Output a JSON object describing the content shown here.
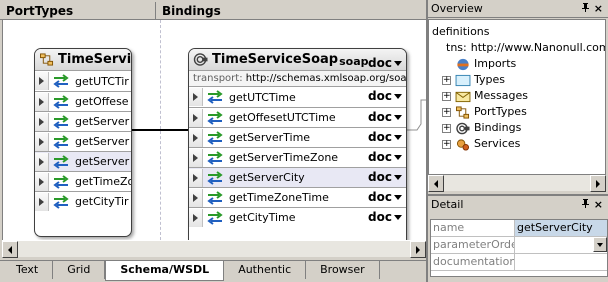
{
  "main": {
    "headers": {
      "porttypes": "PortTypes",
      "bindings": "Bindings"
    },
    "porttype_box": {
      "title": "TimeServic",
      "operations": [
        "getUTCTir",
        "getOffese",
        "getServer",
        "getServer",
        "getServer",
        "getTimeZo",
        "getCityTir"
      ]
    },
    "binding_box": {
      "title": "TimeServiceSoap",
      "subtitle": "soap",
      "style": "doc",
      "transport_label": "transport:",
      "transport_value": "http://schemas.xmlsoap.org/soa",
      "operations": [
        {
          "label": "getUTCTime",
          "style": "doc"
        },
        {
          "label": "getOffesetUTCTime",
          "style": "doc"
        },
        {
          "label": "getServerTime",
          "style": "doc"
        },
        {
          "label": "getServerTimeZone",
          "style": "doc"
        },
        {
          "label": "getServerCity",
          "style": "doc"
        },
        {
          "label": "getTimeZoneTime",
          "style": "doc"
        },
        {
          "label": "getCityTime",
          "style": "doc"
        }
      ]
    },
    "tabs": [
      "Text",
      "Grid",
      "Schema/WSDL",
      "Authentic",
      "Browser"
    ],
    "active_tab": "Schema/WSDL"
  },
  "overview": {
    "title": "Overview",
    "pin": "\u0004",
    "close": "×",
    "definitions": "definitions",
    "tns_label": "tns:",
    "tns_value": "http://www.Nanonull.com/",
    "items": [
      {
        "label": "Imports",
        "icon": "imports-icon",
        "expandable": false
      },
      {
        "label": "Types",
        "icon": "types-icon",
        "expandable": true
      },
      {
        "label": "Messages",
        "icon": "messages-icon",
        "expandable": true
      },
      {
        "label": "PortTypes",
        "icon": "porttypes-icon",
        "expandable": true
      },
      {
        "label": "Bindings",
        "icon": "bindings-icon",
        "expandable": true
      },
      {
        "label": "Services",
        "icon": "services-icon",
        "expandable": true
      }
    ]
  },
  "detail": {
    "title": "Detail",
    "rows": [
      {
        "name": "name",
        "value": "getServerCity"
      },
      {
        "name": "parameterOrder",
        "value": ""
      },
      {
        "name": "documentation",
        "value": ""
      }
    ]
  }
}
